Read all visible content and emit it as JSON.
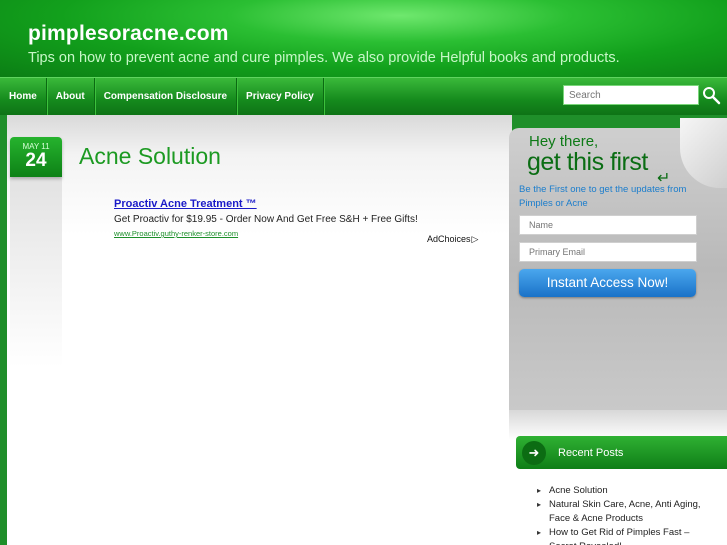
{
  "site": {
    "title": "pimplesoracne.com",
    "tagline": "Tips on how to prevent acne and cure pimples. We also provide Helpful books and products."
  },
  "nav": {
    "items": [
      "Home",
      "About",
      "Compensation Disclosure",
      "Privacy Policy"
    ],
    "search_placeholder": "Search",
    "search_icon": "magnifier-icon"
  },
  "post": {
    "date_month": "MAY 11",
    "date_day": "24",
    "title": "Acne Solution"
  },
  "ad": {
    "title": "Proactiv Acne Treatment ™",
    "description": "Get Proactiv for $19.95 - Order Now And Get Free S&H + Free Gifts!",
    "url": "www.Proactiv.guthy-renker-store.com",
    "adchoices": "AdChoices"
  },
  "optin": {
    "heading_small": "Hey there,",
    "heading_large": "get this first",
    "text": "Be the First one to get the updates from Pimples or Acne",
    "name_placeholder": "Name",
    "email_placeholder": "Primary Email",
    "button_label": "Instant Access Now!"
  },
  "recent_posts": {
    "title": "Recent Posts",
    "items": [
      "Acne Solution",
      "Natural Skin Care, Acne, Anti Aging, Face & Acne Products",
      "How to Get Rid of Pimples Fast – Secret Revealed!"
    ]
  },
  "colors": {
    "brand_green": "#12a01c",
    "title_green": "#1c9a22",
    "button_blue": "#1a72c8",
    "link_blue": "#1a1ac8"
  }
}
